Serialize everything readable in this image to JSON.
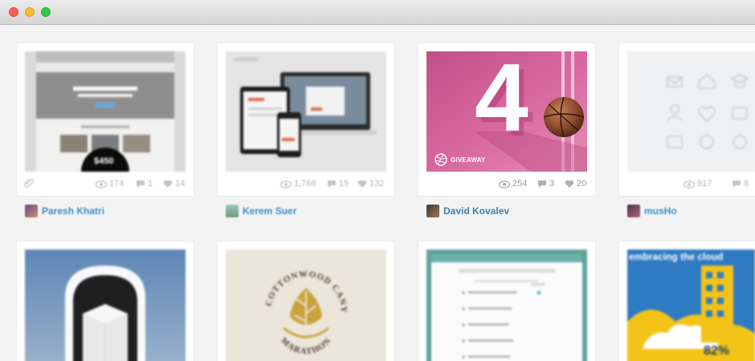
{
  "window": {
    "controls": [
      "close",
      "minimize",
      "zoom"
    ]
  },
  "shots": [
    {
      "author": "Paresh Khatri",
      "views": "174",
      "comments": "1",
      "likes": "14",
      "preview": {
        "price": "$450"
      }
    },
    {
      "author": "Kerem Suer",
      "views": "1,766",
      "comments": "15",
      "likes": "132"
    },
    {
      "author": "David Kovalev",
      "views": "254",
      "comments": "3",
      "likes": "20",
      "preview": {
        "big_number": "4",
        "badge": "GIVEAWAY"
      }
    },
    {
      "author": "musHo",
      "views": "917",
      "comments": "8",
      "likes": ""
    },
    {
      "author": ""
    },
    {
      "author": "",
      "preview": {
        "arc_top": "BIG COTTONWOOD CANYON",
        "arc_bottom": "MARATHON"
      }
    },
    {
      "author": ""
    },
    {
      "author": "",
      "preview": {
        "headline": "embracing the cloud",
        "percent": "82%"
      }
    }
  ],
  "colors": {
    "link": "#3a8fc9",
    "stat": "#a0a0a0",
    "dribbble_pink": "#d74c8a"
  }
}
